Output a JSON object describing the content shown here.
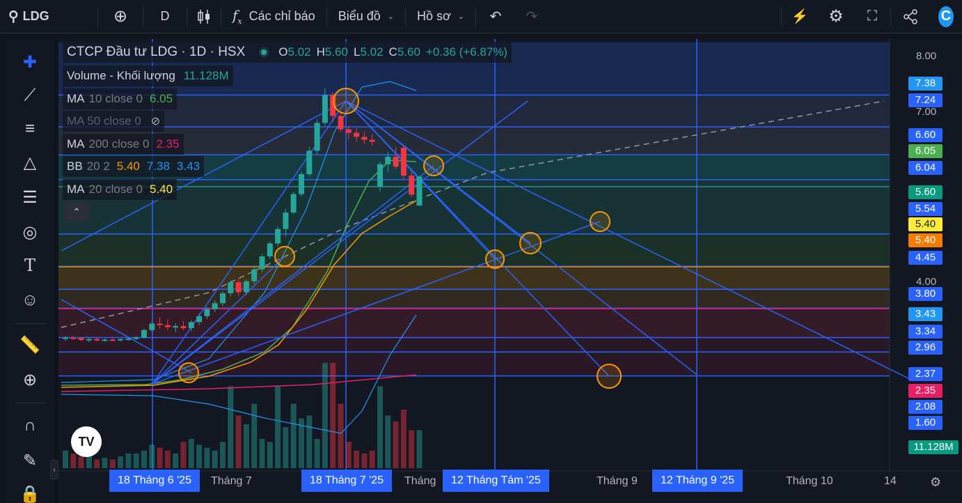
{
  "toolbar": {
    "symbol": "LDG",
    "interval": "D",
    "indicators_label": "Các chỉ báo",
    "chart_label": "Biểu đồ",
    "profile_label": "Hồ sơ"
  },
  "legend": {
    "title": "CTCP Đầu tư LDG · 1D · HSX",
    "o_label": "O",
    "o_value": "5.02",
    "h_label": "H",
    "h_value": "5.60",
    "l_label": "L",
    "l_value": "5.02",
    "c_label": "C",
    "c_value": "5.60",
    "change": "+0.36 (+6.87%)",
    "volume_label": "Volume - Khối lượng",
    "volume_value": "11.128M",
    "ma10_label": "MA",
    "ma10_params": "10 close 0",
    "ma10_value": "6.05",
    "ma50_label": "MA 50 close 0",
    "ma200_label": "MA",
    "ma200_params": "200 close 0",
    "ma200_value": "2.35",
    "bb_label": "BB",
    "bb_params": "20 2",
    "bb_mid": "5.40",
    "bb_upper": "7.38",
    "bb_lower": "3.43",
    "ma20_label": "MA",
    "ma20_params": "20 close 0",
    "ma20_value": "5.40"
  },
  "price_ticks": [
    "8.00",
    "7.00",
    "4.00"
  ],
  "price_labels": [
    {
      "text": "7.38",
      "bg": "#2196f3",
      "fg": "#ffffff"
    },
    {
      "text": "7.24",
      "bg": "#2962ff",
      "fg": "#ffffff"
    },
    {
      "text": "6.60",
      "bg": "#2962ff",
      "fg": "#ffffff"
    },
    {
      "text": "6.05",
      "bg": "#4caf50",
      "fg": "#ffffff"
    },
    {
      "text": "6.04",
      "bg": "#2962ff",
      "fg": "#ffffff"
    },
    {
      "text": "5.60",
      "bg": "#089981",
      "fg": "#ffffff"
    },
    {
      "text": "5.54",
      "bg": "#2962ff",
      "fg": "#ffffff"
    },
    {
      "text": "5.40",
      "bg": "#ffeb3b",
      "fg": "#131722"
    },
    {
      "text": "5.40",
      "bg": "#f57c00",
      "fg": "#ffffff"
    },
    {
      "text": "4.45",
      "bg": "#2962ff",
      "fg": "#ffffff"
    },
    {
      "text": "3.80",
      "bg": "#2962ff",
      "fg": "#ffffff"
    },
    {
      "text": "3.43",
      "bg": "#2196f3",
      "fg": "#ffffff"
    },
    {
      "text": "3.34",
      "bg": "#2962ff",
      "fg": "#ffffff"
    },
    {
      "text": "2.96",
      "bg": "#2962ff",
      "fg": "#ffffff"
    },
    {
      "text": "2.37",
      "bg": "#2962ff",
      "fg": "#ffffff"
    },
    {
      "text": "2.35",
      "bg": "#e91e63",
      "fg": "#ffffff"
    },
    {
      "text": "2.08",
      "bg": "#2962ff",
      "fg": "#ffffff"
    },
    {
      "text": "1.60",
      "bg": "#2962ff",
      "fg": "#ffffff"
    },
    {
      "text": "11.128M",
      "bg": "#089981",
      "fg": "#ffffff"
    }
  ],
  "time_axis": {
    "highlighted": [
      "18 Tháng 6 '25",
      "18 Tháng 7 '25",
      "12 Tháng Tám '25",
      "12 Tháng 9 '25"
    ],
    "plain": [
      "Tháng 7",
      "Tháng",
      "Tháng 9",
      "Tháng 10",
      "14"
    ]
  },
  "logo_text": "TV",
  "icons": {
    "search": "search-icon",
    "add": "plus-circle-icon",
    "candles": "candlestick-icon",
    "fx": "fx-icon",
    "undo": "undo-icon",
    "redo": "redo-icon",
    "alert": "alert-icon",
    "settings": "gear-icon",
    "fullscreen": "fullscreen-icon",
    "share": "share-icon",
    "crosshair": "crosshair-icon",
    "trendline": "trendline-icon",
    "fib": "fib-icon",
    "patterns": "pattern-icon",
    "forecast": "forecast-icon",
    "shapes": "shapes-icon",
    "text": "text-icon",
    "emoji": "emoji-icon",
    "ruler": "ruler-icon",
    "zoom": "zoom-in-icon",
    "magnet": "magnet-icon",
    "pencil": "pencil-lock-icon",
    "lock": "lock-icon"
  },
  "colors": {
    "up": "#26a69a",
    "down": "#f23645",
    "accent": "#2962ff",
    "ma10": "#4caf50",
    "ma20": "#ffeb3b",
    "bb": "#2196f3",
    "ma200": "#e91e63"
  },
  "chart_data": {
    "type": "candlestick",
    "title": "CTCP Đầu tư LDG · 1D · HSX",
    "ylim": [
      1.4,
      8.3
    ],
    "candles": [
      {
        "o": 2.35,
        "h": 2.4,
        "l": 2.3,
        "c": 2.37
      },
      {
        "o": 2.37,
        "h": 2.4,
        "l": 2.33,
        "c": 2.36
      },
      {
        "o": 2.36,
        "h": 2.38,
        "l": 2.3,
        "c": 2.32
      },
      {
        "o": 2.32,
        "h": 2.36,
        "l": 2.28,
        "c": 2.34
      },
      {
        "o": 2.34,
        "h": 2.37,
        "l": 2.3,
        "c": 2.31
      },
      {
        "o": 2.31,
        "h": 2.35,
        "l": 2.29,
        "c": 2.33
      },
      {
        "o": 2.33,
        "h": 2.36,
        "l": 2.3,
        "c": 2.32
      },
      {
        "o": 2.32,
        "h": 2.35,
        "l": 2.29,
        "c": 2.34
      },
      {
        "o": 2.34,
        "h": 2.38,
        "l": 2.31,
        "c": 2.35
      },
      {
        "o": 2.35,
        "h": 2.4,
        "l": 2.32,
        "c": 2.37
      },
      {
        "o": 2.37,
        "h": 2.55,
        "l": 2.35,
        "c": 2.52
      },
      {
        "o": 2.52,
        "h": 2.7,
        "l": 2.48,
        "c": 2.65
      },
      {
        "o": 2.65,
        "h": 2.78,
        "l": 2.55,
        "c": 2.62
      },
      {
        "o": 2.62,
        "h": 2.74,
        "l": 2.52,
        "c": 2.58
      },
      {
        "o": 2.58,
        "h": 2.66,
        "l": 2.48,
        "c": 2.6
      },
      {
        "o": 2.6,
        "h": 2.7,
        "l": 2.52,
        "c": 2.56
      },
      {
        "o": 2.56,
        "h": 2.72,
        "l": 2.5,
        "c": 2.68
      },
      {
        "o": 2.68,
        "h": 2.86,
        "l": 2.62,
        "c": 2.8
      },
      {
        "o": 2.8,
        "h": 2.98,
        "l": 2.74,
        "c": 2.94
      },
      {
        "o": 2.94,
        "h": 3.12,
        "l": 2.88,
        "c": 3.06
      },
      {
        "o": 3.06,
        "h": 3.3,
        "l": 3.0,
        "c": 3.26
      },
      {
        "o": 3.26,
        "h": 3.52,
        "l": 3.2,
        "c": 3.48
      },
      {
        "o": 3.48,
        "h": 3.56,
        "l": 3.2,
        "c": 3.28
      },
      {
        "o": 3.28,
        "h": 3.54,
        "l": 3.22,
        "c": 3.5
      },
      {
        "o": 3.5,
        "h": 3.8,
        "l": 3.45,
        "c": 3.74
      },
      {
        "o": 3.74,
        "h": 4.05,
        "l": 3.68,
        "c": 4.0
      },
      {
        "o": 4.0,
        "h": 4.3,
        "l": 3.95,
        "c": 4.26
      },
      {
        "o": 4.26,
        "h": 4.6,
        "l": 4.2,
        "c": 4.55
      },
      {
        "o": 4.55,
        "h": 4.95,
        "l": 4.4,
        "c": 4.88
      },
      {
        "o": 4.88,
        "h": 5.3,
        "l": 4.85,
        "c": 5.25
      },
      {
        "o": 5.25,
        "h": 5.7,
        "l": 5.2,
        "c": 5.65
      },
      {
        "o": 5.65,
        "h": 6.2,
        "l": 5.6,
        "c": 6.12
      },
      {
        "o": 6.12,
        "h": 6.75,
        "l": 6.05,
        "c": 6.68
      },
      {
        "o": 6.68,
        "h": 7.38,
        "l": 6.62,
        "c": 7.24
      },
      {
        "o": 7.24,
        "h": 7.3,
        "l": 6.7,
        "c": 6.82
      },
      {
        "o": 6.82,
        "h": 6.9,
        "l": 6.5,
        "c": 6.55
      },
      {
        "o": 6.55,
        "h": 6.62,
        "l": 6.35,
        "c": 6.48
      },
      {
        "o": 6.48,
        "h": 6.58,
        "l": 6.3,
        "c": 6.4
      },
      {
        "o": 6.4,
        "h": 6.5,
        "l": 6.25,
        "c": 6.34
      },
      {
        "o": 6.34,
        "h": 6.45,
        "l": 6.22,
        "c": 6.3
      },
      {
        "o": 5.4,
        "h": 5.9,
        "l": 5.3,
        "c": 5.85
      },
      {
        "o": 5.85,
        "h": 6.1,
        "l": 5.7,
        "c": 6.0
      },
      {
        "o": 6.0,
        "h": 6.2,
        "l": 5.75,
        "c": 5.8
      },
      {
        "o": 6.18,
        "h": 6.22,
        "l": 5.55,
        "c": 5.62
      },
      {
        "o": 5.62,
        "h": 5.7,
        "l": 5.2,
        "c": 5.24
      },
      {
        "o": 5.02,
        "h": 5.6,
        "l": 5.02,
        "c": 5.6
      }
    ],
    "volume": [
      0.6,
      0.5,
      0.4,
      0.4,
      0.3,
      0.35,
      0.3,
      0.4,
      0.5,
      0.5,
      0.6,
      0.8,
      0.7,
      0.6,
      0.5,
      0.9,
      1.0,
      0.8,
      0.7,
      0.6,
      0.9,
      2.8,
      1.8,
      1.5,
      2.2,
      1.0,
      0.9,
      2.8,
      1.4,
      2.2,
      1.7,
      1.8,
      1.0,
      3.6,
      3.6,
      2.2,
      0.9,
      0.6,
      0.5,
      0.6,
      2.8,
      1.8,
      1.6,
      2.0,
      1.3,
      1.3
    ],
    "horizontal_levels": [
      7.24,
      6.6,
      6.04,
      5.54,
      4.45,
      3.8,
      3.34,
      2.96,
      2.37,
      2.08,
      1.6
    ]
  }
}
